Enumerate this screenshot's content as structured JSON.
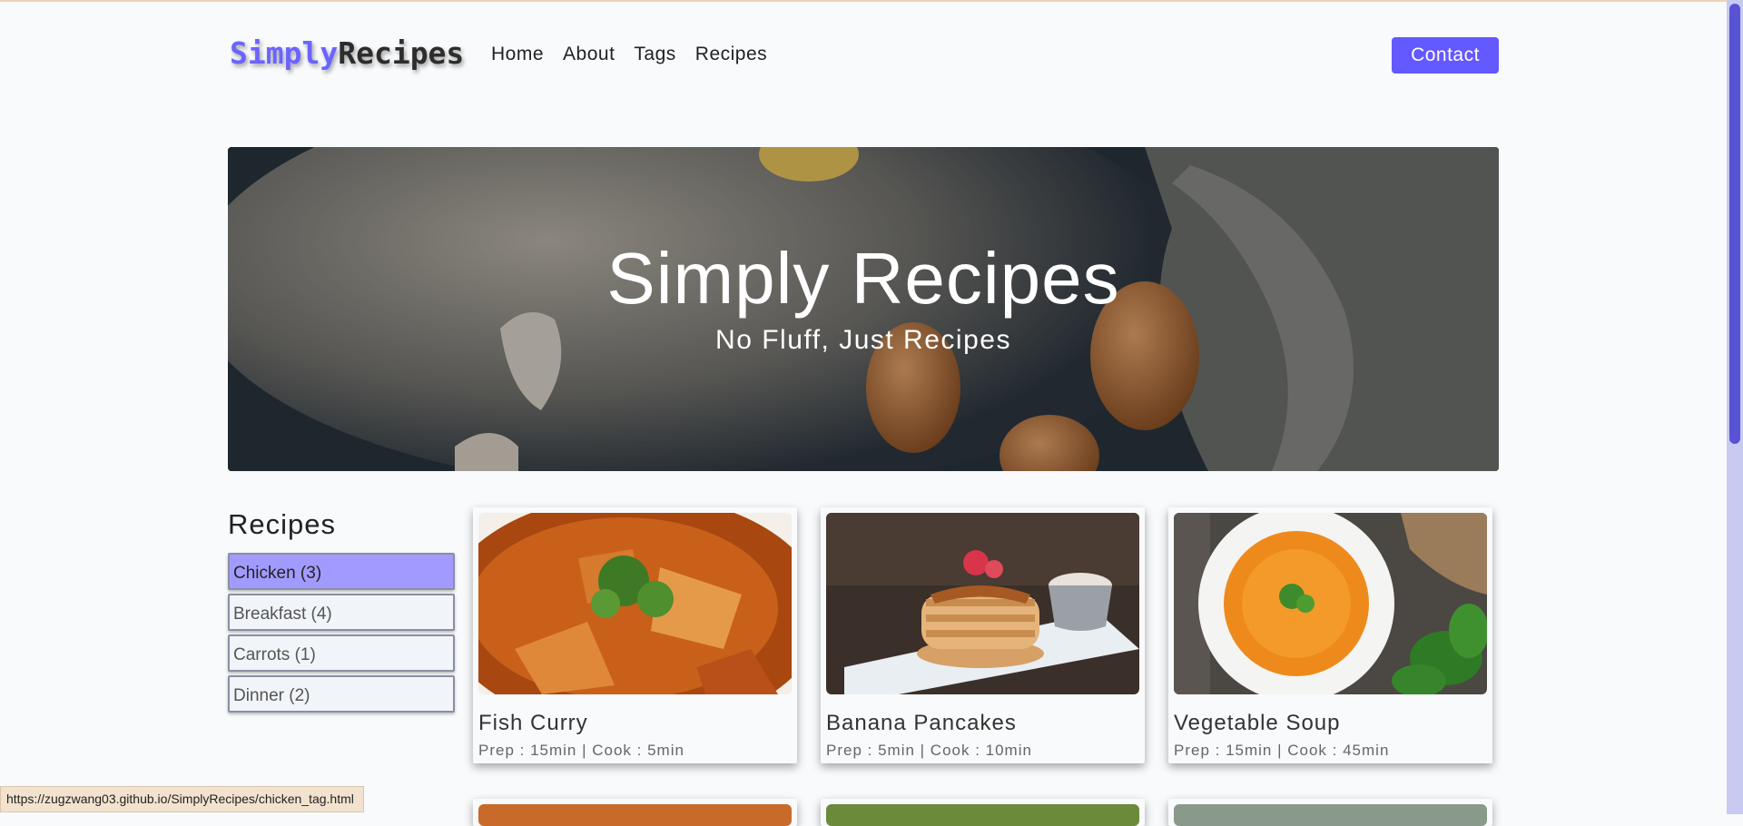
{
  "brand": {
    "part1": "Simply",
    "part2": "Recipes"
  },
  "nav": {
    "links": [
      "Home",
      "About",
      "Tags",
      "Recipes"
    ],
    "contact": "Contact"
  },
  "hero": {
    "title": "Simply Recipes",
    "subtitle": "No Fluff, Just Recipes"
  },
  "sidebar": {
    "title": "Recipes",
    "tags": [
      {
        "label": "Chicken (3)",
        "active": true
      },
      {
        "label": "Breakfast (4)",
        "active": false
      },
      {
        "label": "Carrots (1)",
        "active": false
      },
      {
        "label": "Dinner (2)",
        "active": false
      }
    ]
  },
  "recipes": [
    {
      "name": "Fish Curry",
      "meta": "Prep : 15min | Cook : 5min",
      "image": "fish-curry-photo"
    },
    {
      "name": "Banana Pancakes",
      "meta": "Prep : 5min | Cook : 10min",
      "image": "pancakes-photo"
    },
    {
      "name": "Vegetable Soup",
      "meta": "Prep : 15min | Cook : 45min",
      "image": "soup-photo"
    }
  ],
  "status_url": "https://zugzwang03.github.io/SimplyRecipes/chicken_tag.html",
  "colors": {
    "accent": "#6458ff",
    "active_tag": "#a29bff",
    "scrollbar": "#5a52d4"
  }
}
